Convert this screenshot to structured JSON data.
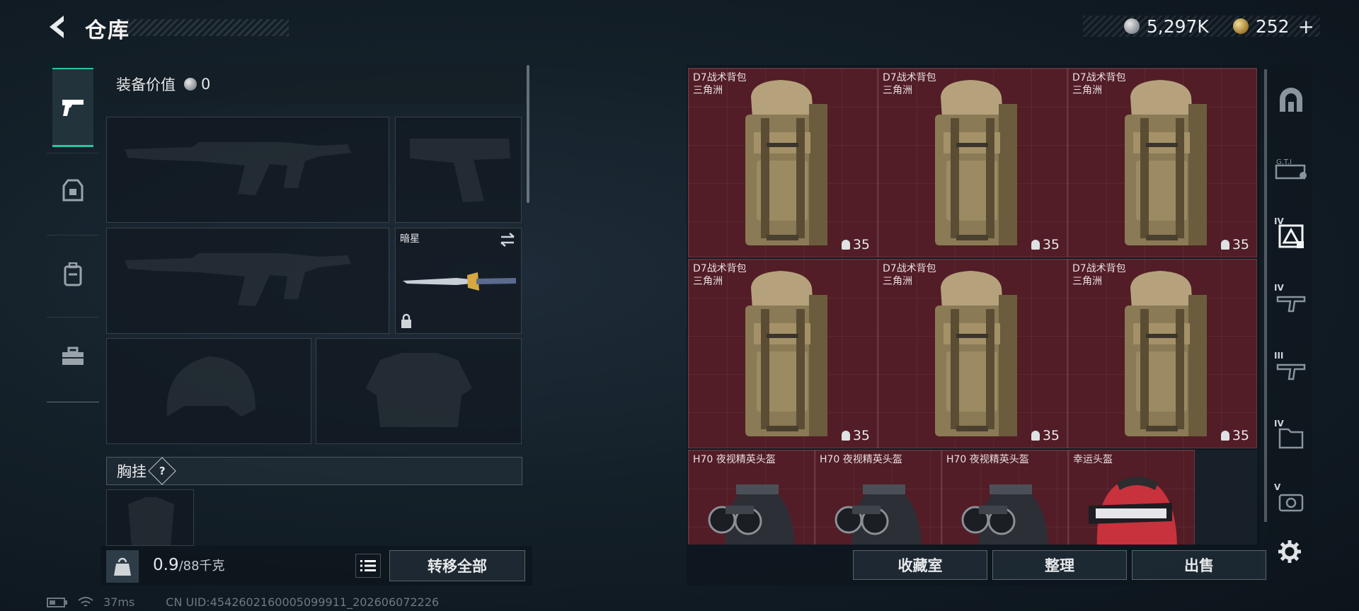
{
  "header": {
    "title": "仓库",
    "currencies": [
      {
        "icon": "silver-coin-icon",
        "value": "5,297K"
      },
      {
        "icon": "gold-coin-icon",
        "value": "252",
        "suffix": "+"
      }
    ]
  },
  "tabs": [
    {
      "name": "weapons",
      "icon": "pistol-icon",
      "active": true
    },
    {
      "name": "armor",
      "icon": "armor-icon",
      "active": false
    },
    {
      "name": "backpack",
      "icon": "backpack-icon",
      "active": false
    },
    {
      "name": "supplies",
      "icon": "toolbox-icon",
      "active": false
    }
  ],
  "equipment": {
    "value_label": "装备价值",
    "value": "0",
    "melee_name": "暗星",
    "rig_label": "胸挂",
    "rig_help": "?",
    "weight_current": "0.9",
    "weight_max": "/88千克",
    "transfer_all": "转移全部"
  },
  "stash": {
    "items": [
      {
        "name": "D7战术背包",
        "sub": "三角洲",
        "weight": "35",
        "type": "backpack"
      },
      {
        "name": "D7战术背包",
        "sub": "三角洲",
        "weight": "35",
        "type": "backpack"
      },
      {
        "name": "D7战术背包",
        "sub": "三角洲",
        "weight": "35",
        "type": "backpack"
      },
      {
        "name": "D7战术背包",
        "sub": "三角洲",
        "weight": "35",
        "type": "backpack"
      },
      {
        "name": "D7战术背包",
        "sub": "三角洲",
        "weight": "35",
        "type": "backpack"
      },
      {
        "name": "D7战术背包",
        "sub": "三角洲",
        "weight": "35",
        "type": "backpack"
      },
      {
        "name": "H70 夜视精英头盔",
        "type": "nv-helmet"
      },
      {
        "name": "H70 夜视精英头盔",
        "type": "nv-helmet"
      },
      {
        "name": "H70 夜视精英头盔",
        "type": "nv-helmet"
      },
      {
        "name": "幸运头盔",
        "type": "lucky-helmet"
      }
    ],
    "buttons": {
      "collection": "收藏室",
      "sort": "整理",
      "sell": "出售"
    }
  },
  "rail": [
    {
      "icon": "all-items-icon",
      "tier": ""
    },
    {
      "icon": "gti-icon",
      "tier": ""
    },
    {
      "icon": "tier4-armor-icon",
      "tier": "IV"
    },
    {
      "icon": "tier4-weapon-icon",
      "tier": "IV"
    },
    {
      "icon": "tier3-weapon-icon",
      "tier": "III"
    },
    {
      "icon": "tier4-folder-icon",
      "tier": "IV"
    },
    {
      "icon": "tier5-camera-icon",
      "tier": "V"
    }
  ],
  "status": {
    "ping": "37ms",
    "uid": "CN UID:4542602160005099911_202606072226"
  }
}
